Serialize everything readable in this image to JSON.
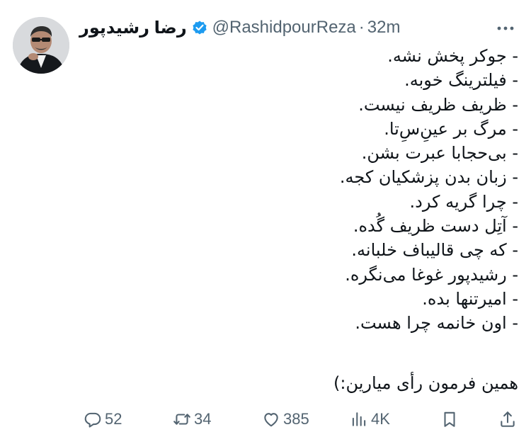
{
  "author": {
    "display_name": "رضا رشیدپور",
    "handle": "@RashidpourReza",
    "separator": "·",
    "time": "32m",
    "verified_color": "#1d9bf0"
  },
  "tweet": {
    "lines": [
      "- جوکر پخش نشه.",
      "- فیلترینگ خوبه.",
      "- ظریف ظریف نیست.",
      "- مرگ بر عینِ‌سِ‌تا.",
      "- بی‌حجابا عبرت بشن.",
      "- زبان بدن پزشکیان کجه.",
      "- چرا گریه کرد.",
      "- آتِل دست ظریف گُده.",
      "- که چی قالیباف خلبانه.",
      "- رشیدپور غوغا می‌نگره.",
      "- امیرتنها بده.",
      "- اون خانمه چرا هست."
    ],
    "closing": "همین فرمون رأی میارین:)"
  },
  "actions": {
    "replies": "52",
    "retweets": "34",
    "likes": "385",
    "views": "4K"
  },
  "icons": {
    "reply": "reply-icon",
    "retweet": "retweet-icon",
    "like": "heart-icon",
    "views": "views-icon",
    "share": "share-icon",
    "more": "more-icon",
    "verified": "verified-badge-icon"
  },
  "colors": {
    "text": "#0f1419",
    "muted": "#536471",
    "verified": "#1d9bf0"
  }
}
